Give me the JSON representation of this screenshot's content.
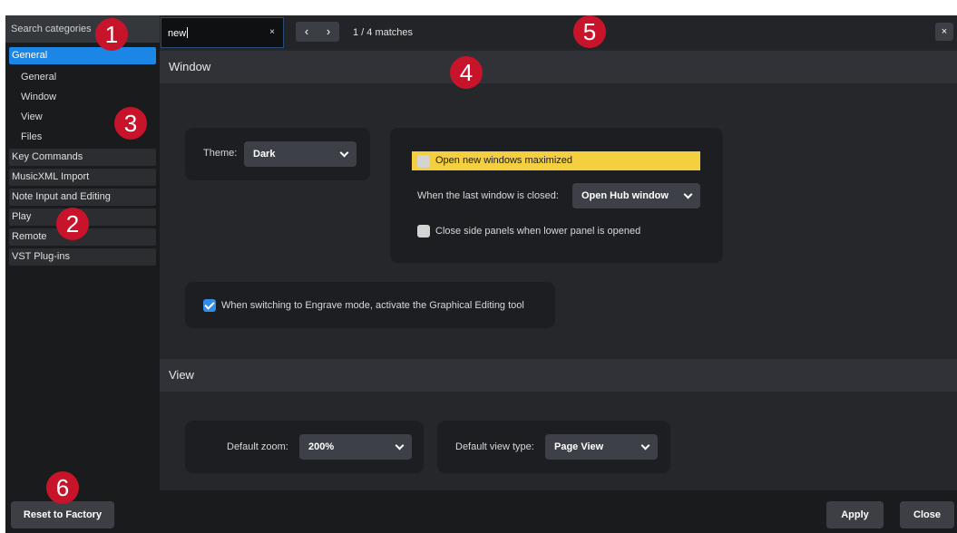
{
  "sidebar": {
    "search_placeholder": "Search categories",
    "categories": [
      {
        "label": "General",
        "active": true
      },
      {
        "label": "Key Commands"
      },
      {
        "label": "MusicXML Import"
      },
      {
        "label": "Note Input and Editing"
      },
      {
        "label": "Play"
      },
      {
        "label": "Remote"
      },
      {
        "label": "VST Plug-ins"
      }
    ],
    "general_subitems": [
      "General",
      "Window",
      "View",
      "Files"
    ]
  },
  "topbar": {
    "search_value": "new",
    "clear_icon": "×",
    "prev_icon": "‹",
    "next_icon": "›",
    "matches": "1 / 4 matches",
    "close_icon": "×"
  },
  "window_section": {
    "title": "Window",
    "theme_label": "Theme:",
    "theme_value": "Dark",
    "open_new_maximized": {
      "label": "Open new windows maximized",
      "checked": false,
      "highlighted": true
    },
    "last_window_label": "When the last window is closed:",
    "last_window_value": "Open Hub window",
    "close_side_panels": {
      "label": "Close side panels when lower panel is opened",
      "checked": false
    },
    "engrave_mode": {
      "label": "When switching to Engrave mode, activate the Graphical Editing tool",
      "checked": true
    }
  },
  "view_section": {
    "title": "View",
    "default_zoom_label": "Default zoom:",
    "default_zoom_value": "200%",
    "default_view_type_label": "Default view type:",
    "default_view_type_value": "Page View"
  },
  "footer": {
    "reset_label": "Reset to Factory",
    "apply_label": "Apply",
    "close_label": "Close"
  },
  "callouts": [
    "1",
    "2",
    "3",
    "4",
    "5",
    "6"
  ],
  "colors": {
    "accent": "#1b86e6",
    "highlight": "#f4cf3f",
    "callout": "#c8142b"
  }
}
